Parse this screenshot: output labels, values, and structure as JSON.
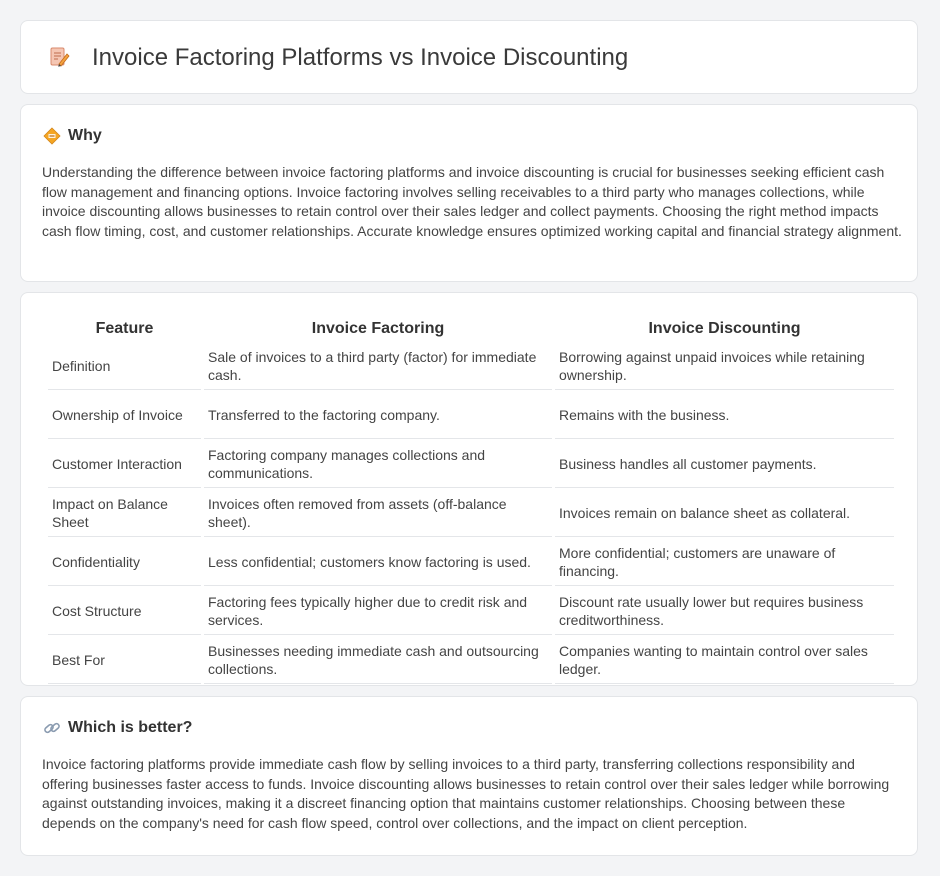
{
  "header": {
    "title": "Invoice Factoring Platforms vs Invoice Discounting",
    "icon": "document-pencil-icon"
  },
  "why": {
    "heading": "Why",
    "icon": "diamond-sign-icon",
    "text": "Understanding the difference between invoice factoring platforms and invoice discounting is crucial for businesses seeking efficient cash flow management and financing options. Invoice factoring involves selling receivables to a third party who manages collections, while invoice discounting allows businesses to retain control over their sales ledger and collect payments. Choosing the right method impacts cash flow timing, cost, and customer relationships. Accurate knowledge ensures optimized working capital and financial strategy alignment."
  },
  "table": {
    "headers": [
      "Feature",
      "Invoice Factoring",
      "Invoice Discounting"
    ],
    "rows": [
      [
        "Definition",
        "Sale of invoices to a third party (factor) for immediate cash.",
        "Borrowing against unpaid invoices while retaining ownership."
      ],
      [
        "Ownership of Invoice",
        "Transferred to the factoring company.",
        "Remains with the business."
      ],
      [
        "Customer Interaction",
        "Factoring company manages collections and communications.",
        "Business handles all customer payments."
      ],
      [
        "Impact on Balance Sheet",
        "Invoices often removed from assets (off-balance sheet).",
        "Invoices remain on balance sheet as collateral."
      ],
      [
        "Confidentiality",
        "Less confidential; customers know factoring is used.",
        "More confidential; customers are unaware of financing."
      ],
      [
        "Cost Structure",
        "Factoring fees typically higher due to credit risk and services.",
        "Discount rate usually lower but requires business creditworthiness."
      ],
      [
        "Best For",
        "Businesses needing immediate cash and outsourcing collections.",
        "Companies wanting to maintain control over sales ledger."
      ]
    ]
  },
  "better": {
    "heading": "Which is better?",
    "icon": "link-icon",
    "text": "Invoice factoring platforms provide immediate cash flow by selling invoices to a third party, transferring collections responsibility and offering businesses faster access to funds. Invoice discounting allows businesses to retain control over their sales ledger while borrowing against outstanding invoices, making it a discreet financing option that maintains customer relationships. Choosing between these depends on the company's need for cash flow speed, control over collections, and the impact on client perception."
  }
}
